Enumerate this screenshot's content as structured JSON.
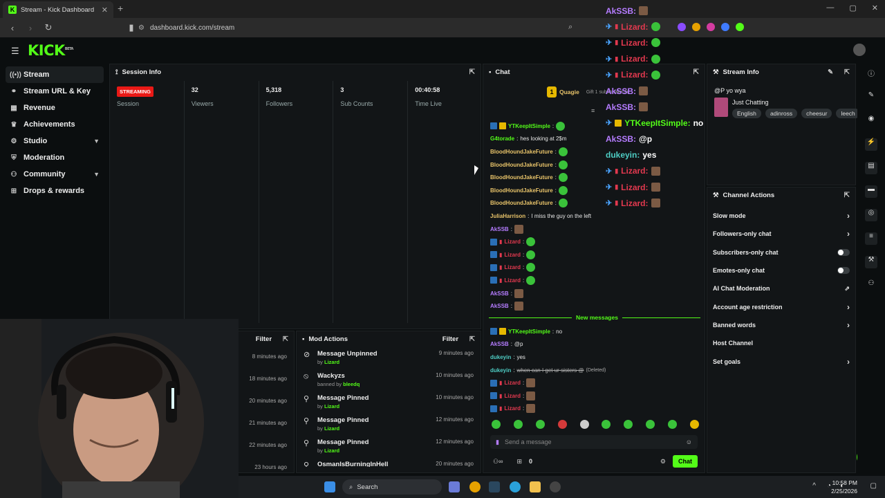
{
  "browser": {
    "tab_title": "Stream - Kick Dashboard",
    "url": "dashboard.kick.com/stream",
    "new_tab": "+",
    "win_controls": [
      "—",
      "▢",
      "✕"
    ]
  },
  "app": {
    "logo": "KICK",
    "logo_sup": "BETA"
  },
  "sidebar": {
    "items": [
      {
        "label": "Stream",
        "icon": "broadcast-icon",
        "active": true
      },
      {
        "label": "Stream URL & Key",
        "icon": "link-icon"
      },
      {
        "label": "Revenue",
        "icon": "revenue-icon"
      },
      {
        "label": "Achievements",
        "icon": "trophy-icon"
      },
      {
        "label": "Studio",
        "icon": "studio-icon",
        "chevron": true
      },
      {
        "label": "Moderation",
        "icon": "shield-icon"
      },
      {
        "label": "Community",
        "icon": "community-icon",
        "chevron": true
      },
      {
        "label": "Drops & rewards",
        "icon": "gift-icon"
      }
    ]
  },
  "session": {
    "title": "Session Info",
    "badge": "STREAMING",
    "stats": [
      {
        "value": "",
        "label": "Session"
      },
      {
        "value": "32",
        "label": "Viewers"
      },
      {
        "value": "5,318",
        "label": "Followers"
      },
      {
        "value": "3",
        "label": "Sub Counts"
      },
      {
        "value": "00:40:58",
        "label": "Time Live"
      }
    ]
  },
  "left_panel_bottom": {
    "filter": "Filter",
    "times": [
      "8 minutes ago",
      "18 minutes ago",
      "20 minutes ago",
      "21 minutes ago",
      "22 minutes ago",
      "23 hours ago"
    ]
  },
  "mod_actions": {
    "title": "Mod Actions",
    "filter": "Filter",
    "rows": [
      {
        "icon": "unpin-icon",
        "action": "Message Unpinned",
        "by_prefix": "by",
        "by": "Lizard",
        "time": "9 minutes ago"
      },
      {
        "icon": "ban-icon",
        "action": "Wackyzs",
        "by_prefix": "banned by",
        "by": "bleedq",
        "time": "10 minutes ago"
      },
      {
        "icon": "pin-icon",
        "action": "Message Pinned",
        "by_prefix": "by",
        "by": "Lizard",
        "time": "10 minutes ago"
      },
      {
        "icon": "pin-icon",
        "action": "Message Pinned",
        "by_prefix": "by",
        "by": "Lizard",
        "time": "12 minutes ago"
      },
      {
        "icon": "pin-icon",
        "action": "Message Pinned",
        "by_prefix": "by",
        "by": "Lizard",
        "time": "12 minutes ago"
      },
      {
        "icon": "pin-icon",
        "action": "OsmanIsBurningInHell",
        "by_prefix": "",
        "by": "",
        "time": "20 minutes ago"
      }
    ]
  },
  "chat": {
    "title": "Chat",
    "pinned_user": "Quagie",
    "pinned_count": "1",
    "gift_label": "Gift 1 sub to take 2n",
    "messages": [
      {
        "user": "YTKeepItSimple",
        "color": "green",
        "text": "",
        "badges": true,
        "emote": true
      },
      {
        "user": "G4torade",
        "color": "green",
        "text": "hes looking at 2$m"
      },
      {
        "user": "BloodHoundJakeFuture",
        "color": "yellow",
        "text": "",
        "emote": true
      },
      {
        "user": "BloodHoundJakeFuture",
        "color": "yellow",
        "text": "",
        "emote": true
      },
      {
        "user": "BloodHoundJakeFuture",
        "color": "yellow",
        "text": "",
        "emote": true
      },
      {
        "user": "BloodHoundJakeFuture",
        "color": "yellow",
        "text": "",
        "emote": true
      },
      {
        "user": "BloodHoundJakeFuture",
        "color": "yellow",
        "text": "",
        "emote": true
      },
      {
        "user": "JuliaHarrison",
        "color": "yellow",
        "text": "I miss the guy on the left"
      },
      {
        "user": "AkSSB",
        "color": "purple",
        "text": "",
        "face": true
      },
      {
        "user": "Lizard",
        "color": "red",
        "text": "",
        "badges": true,
        "emote": true
      },
      {
        "user": "Lizard",
        "color": "red",
        "text": "",
        "badges": true,
        "emote": true
      },
      {
        "user": "Lizard",
        "color": "red",
        "text": "",
        "badges": true,
        "emote": true
      },
      {
        "user": "Lizard",
        "color": "red",
        "text": "",
        "badges": true,
        "emote": true
      },
      {
        "user": "AkSSB",
        "color": "purple",
        "text": "",
        "face": true
      },
      {
        "user": "AkSSB",
        "color": "purple",
        "text": "",
        "face": true
      }
    ],
    "new_messages_label": "New messages",
    "new_messages": [
      {
        "user": "YTKeepItSimple",
        "color": "green",
        "text": "no",
        "badges": true
      },
      {
        "user": "AkSSB",
        "color": "purple",
        "text": "@p"
      },
      {
        "user": "dukeyin",
        "color": "teal",
        "text": "yes"
      },
      {
        "user": "dukeyin",
        "color": "teal",
        "text": "when can I get ur sisters @",
        "deleted": "(Deleted)"
      },
      {
        "user": "Lizard",
        "color": "red",
        "text": "",
        "badges": true,
        "face": true
      },
      {
        "user": "Lizard",
        "color": "red",
        "text": "",
        "badges": true,
        "face": true
      },
      {
        "user": "Lizard",
        "color": "red",
        "text": "",
        "badges": true,
        "face": true
      }
    ],
    "input_placeholder": "Send a message",
    "counter": "0",
    "send_label": "Chat"
  },
  "stream_info": {
    "title": "Stream Info",
    "stream_title": "@P yo wya",
    "category": "Just Chatting",
    "tags": [
      "English",
      "adinross",
      "cheesur",
      "leech"
    ]
  },
  "channel_actions": {
    "title": "Channel Actions",
    "items": [
      {
        "label": "Slow mode",
        "control": "chevron"
      },
      {
        "label": "Followers-only chat",
        "control": "chevron"
      },
      {
        "label": "Subscribers-only chat",
        "control": "toggle"
      },
      {
        "label": "Emotes-only chat",
        "control": "toggle"
      },
      {
        "label": "AI Chat Moderation",
        "control": "external"
      },
      {
        "label": "Account age restriction",
        "control": "chevron"
      },
      {
        "label": "Banned words",
        "control": "chevron"
      },
      {
        "label": "Host Channel",
        "control": "none"
      },
      {
        "label": "Set goals",
        "control": "chevron"
      }
    ]
  },
  "overlay": {
    "lines": [
      {
        "user": "AkSSB:",
        "color": "purple",
        "pin": false,
        "face": true
      },
      {
        "user": "Lizard:",
        "color": "red",
        "pin": true,
        "emote": true
      },
      {
        "user": "Lizard:",
        "color": "red",
        "pin": true,
        "emote": true
      },
      {
        "user": "Lizard:",
        "color": "red",
        "pin": true,
        "emote": true
      },
      {
        "user": "Lizard:",
        "color": "red",
        "pin": true,
        "emote": true
      },
      {
        "user": "AkSSB:",
        "color": "purple",
        "pin": false,
        "face": true
      },
      {
        "user": "AkSSB:",
        "color": "purple",
        "pin": false,
        "face": true
      },
      {
        "user": "YTKeepItSimple:",
        "color": "green",
        "pin": true,
        "text": "no"
      },
      {
        "user": "AkSSB:",
        "color": "purple",
        "pin": false,
        "text": "@p"
      },
      {
        "user": "dukeyin:",
        "color": "teal",
        "pin": false,
        "text": "yes"
      },
      {
        "user": "Lizard:",
        "color": "red",
        "pin": true,
        "face": true
      },
      {
        "user": "Lizard:",
        "color": "red",
        "pin": true,
        "face": true
      },
      {
        "user": "Lizard:",
        "color": "red",
        "pin": true,
        "face": true
      }
    ]
  },
  "taskbar": {
    "search": "Search",
    "time": "10:58 PM",
    "date": "2/25/2026"
  },
  "colors": {
    "brand": "#53fc18",
    "live": "#e91916"
  }
}
